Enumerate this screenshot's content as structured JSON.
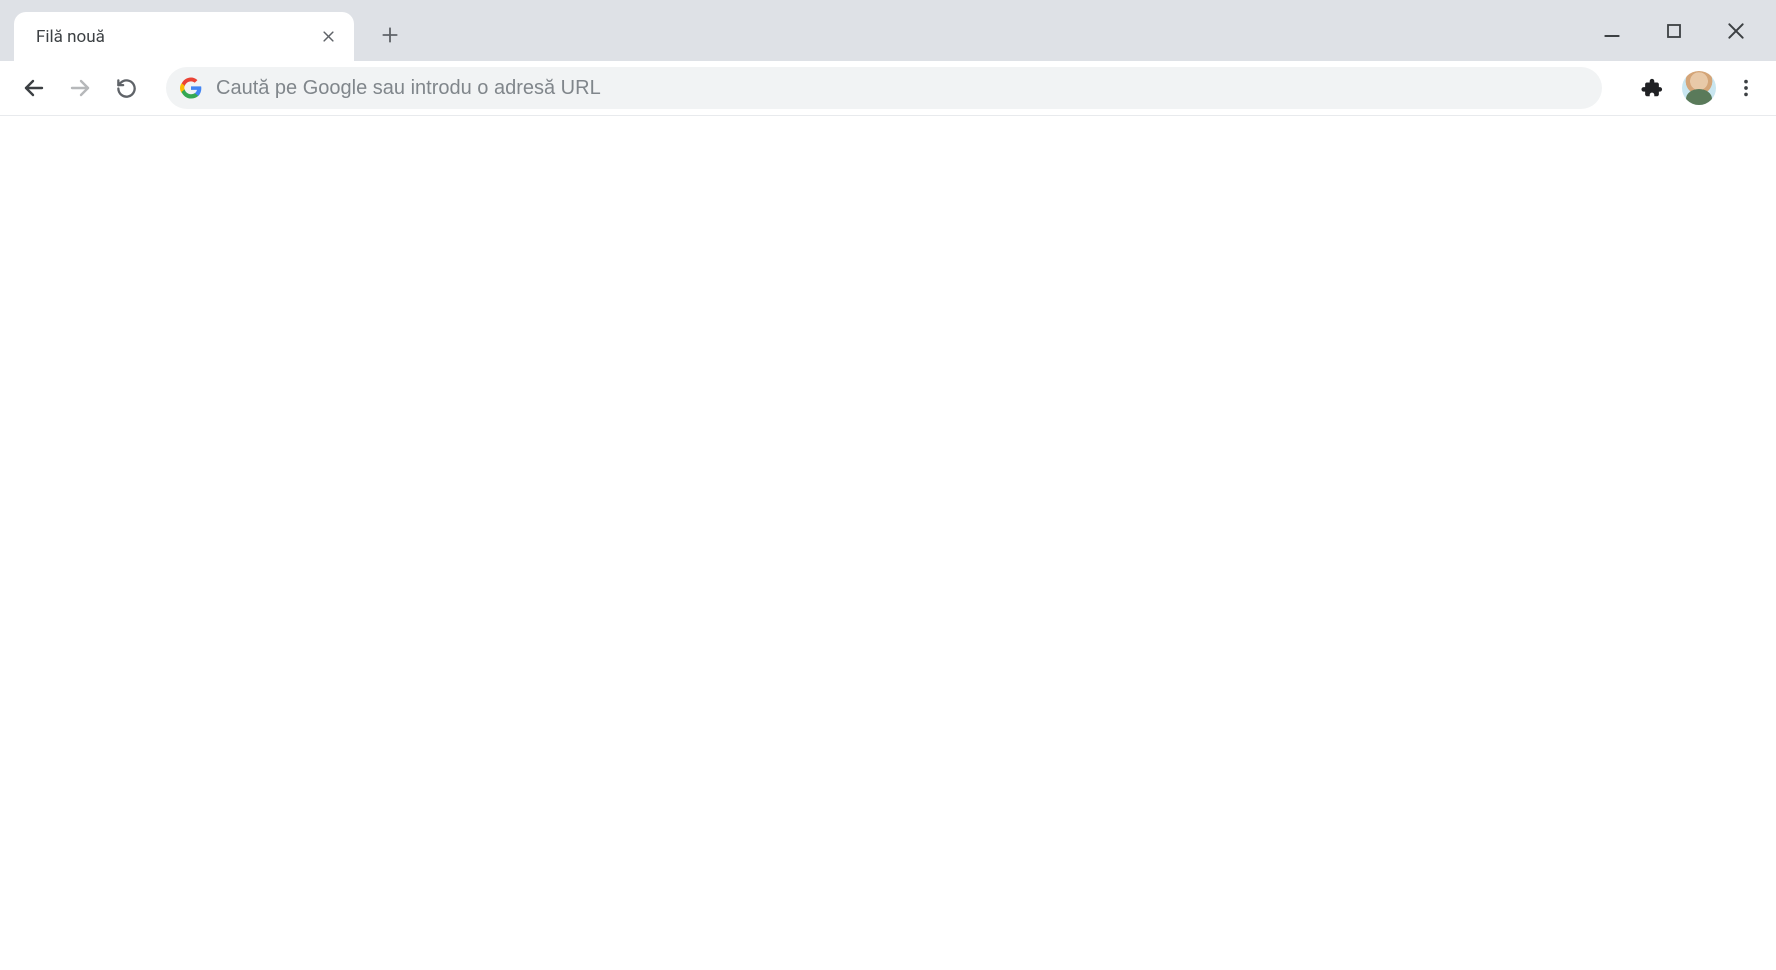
{
  "tab": {
    "title": "Filă nouă"
  },
  "omnibox": {
    "placeholder": "Caută pe Google sau introdu o adresă URL",
    "value": ""
  }
}
